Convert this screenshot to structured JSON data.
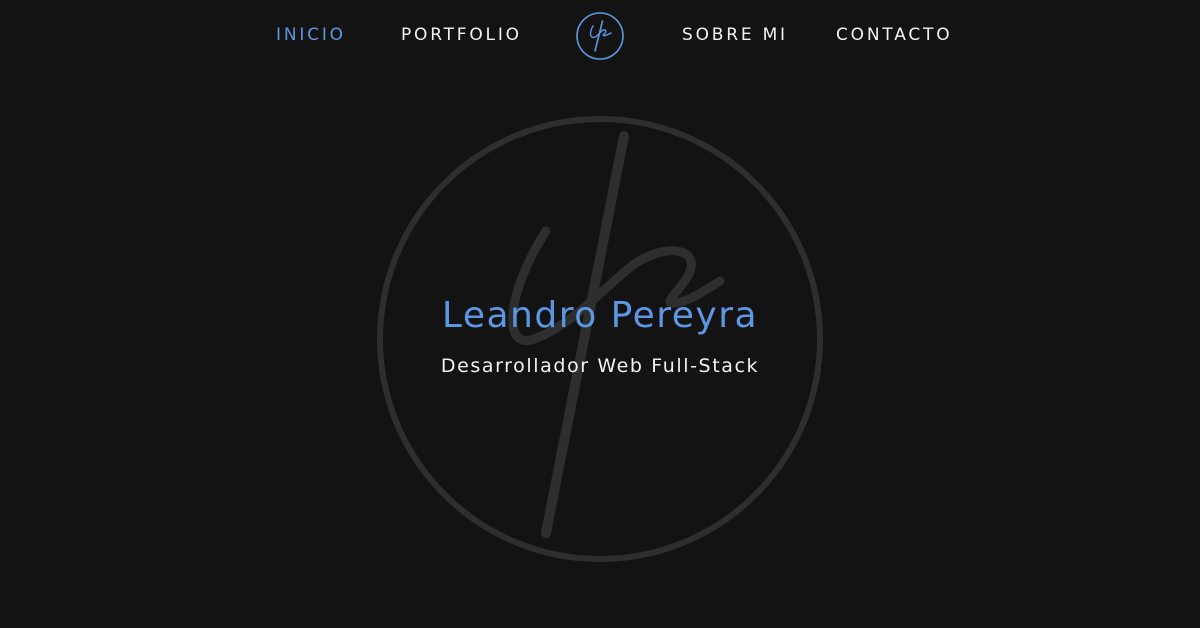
{
  "nav": {
    "items": [
      {
        "label": "INICIO",
        "active": true
      },
      {
        "label": "PORTFOLIO",
        "active": false
      },
      {
        "label": "SOBRE MI",
        "active": false
      },
      {
        "label": "CONTACTO",
        "active": false
      }
    ],
    "logo_icon": "lp-monogram-icon"
  },
  "hero": {
    "name": "Leandro Pereyra",
    "subtitle": "Desarrollador Web Full-Stack",
    "emblem_icon": "lp-monogram-emblem"
  },
  "colors": {
    "background": "#131313",
    "accent": "#5b97e3",
    "text": "#f2f2f2",
    "emblem": "#2e2e2e"
  }
}
